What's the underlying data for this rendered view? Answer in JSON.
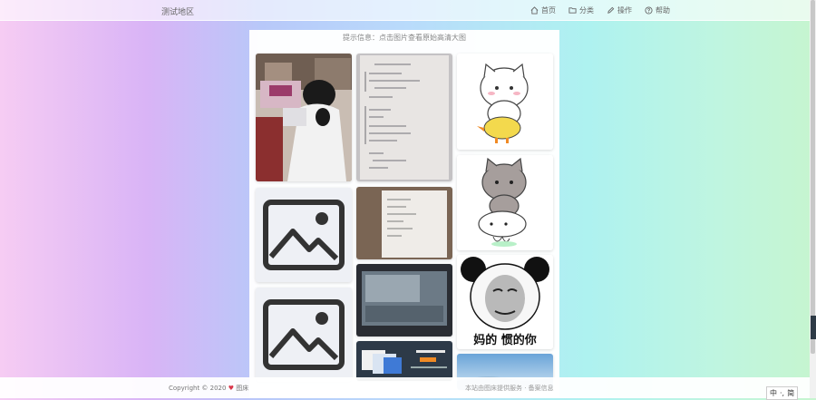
{
  "header": {
    "brand": "测试地区",
    "nav": [
      {
        "label": "首页",
        "icon": "home-icon"
      },
      {
        "label": "分类",
        "icon": "folder-icon"
      },
      {
        "label": "操作",
        "icon": "edit-icon"
      },
      {
        "label": "帮助",
        "icon": "help-icon"
      }
    ]
  },
  "gallery": {
    "notice": "提示信息：点击图片查看原始高清大图",
    "meme_caption": "妈的 惯的你"
  },
  "footer": {
    "copyright": "Copyright © 2020",
    "owner": "图床",
    "info": "本站由图床提供服务 · 备案信息"
  },
  "ime": {
    "mode": "中",
    "punct": "·,",
    "label": "简"
  }
}
